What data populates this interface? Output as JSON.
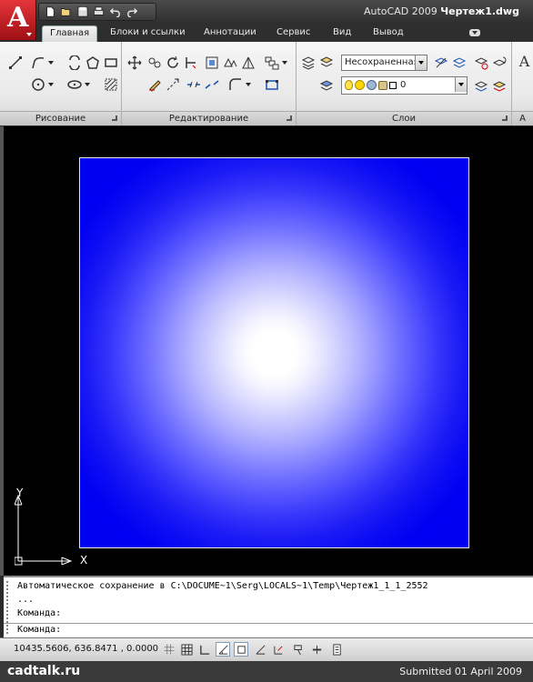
{
  "window": {
    "app_name": "AutoCAD 2009",
    "document_name": "Чертеж1.dwg"
  },
  "quick_access": {
    "icons": [
      "new-icon",
      "open-icon",
      "save-icon",
      "print-icon",
      "undo-icon",
      "redo-icon"
    ]
  },
  "ribbon": {
    "tabs": [
      {
        "label": "Главная",
        "active": true
      },
      {
        "label": "Блоки и ссылки",
        "active": false
      },
      {
        "label": "Аннотации",
        "active": false
      },
      {
        "label": "Сервис",
        "active": false
      },
      {
        "label": "Вид",
        "active": false
      },
      {
        "label": "Вывод",
        "active": false
      }
    ],
    "panels": {
      "draw": {
        "title": "Рисование"
      },
      "modify": {
        "title": "Редактирование"
      },
      "layers": {
        "title": "Слои",
        "layer_state": "Несохраненная",
        "current_layer": "0"
      },
      "annotation": {
        "title": "А"
      }
    }
  },
  "drawing": {
    "hatch_colors": {
      "center": "#ffffff",
      "edge": "#0000f0",
      "border": "#e8e8e8"
    },
    "ucs": {
      "x_label": "X",
      "y_label": "Y"
    }
  },
  "command_line": {
    "lines": [
      "Автоматическое сохранение в C:\\DOCUME~1\\Serg\\LOCALS~1\\Temp\\Чертеж1_1_1_2552",
      "...",
      "Команда:"
    ],
    "prompt": "Команда:"
  },
  "status_bar": {
    "coordinates": "10435.5606, 636.8471 , 0.0000"
  },
  "footer": {
    "site": "cadtalk.ru",
    "submitted": "Submitted 01 April 2009"
  }
}
